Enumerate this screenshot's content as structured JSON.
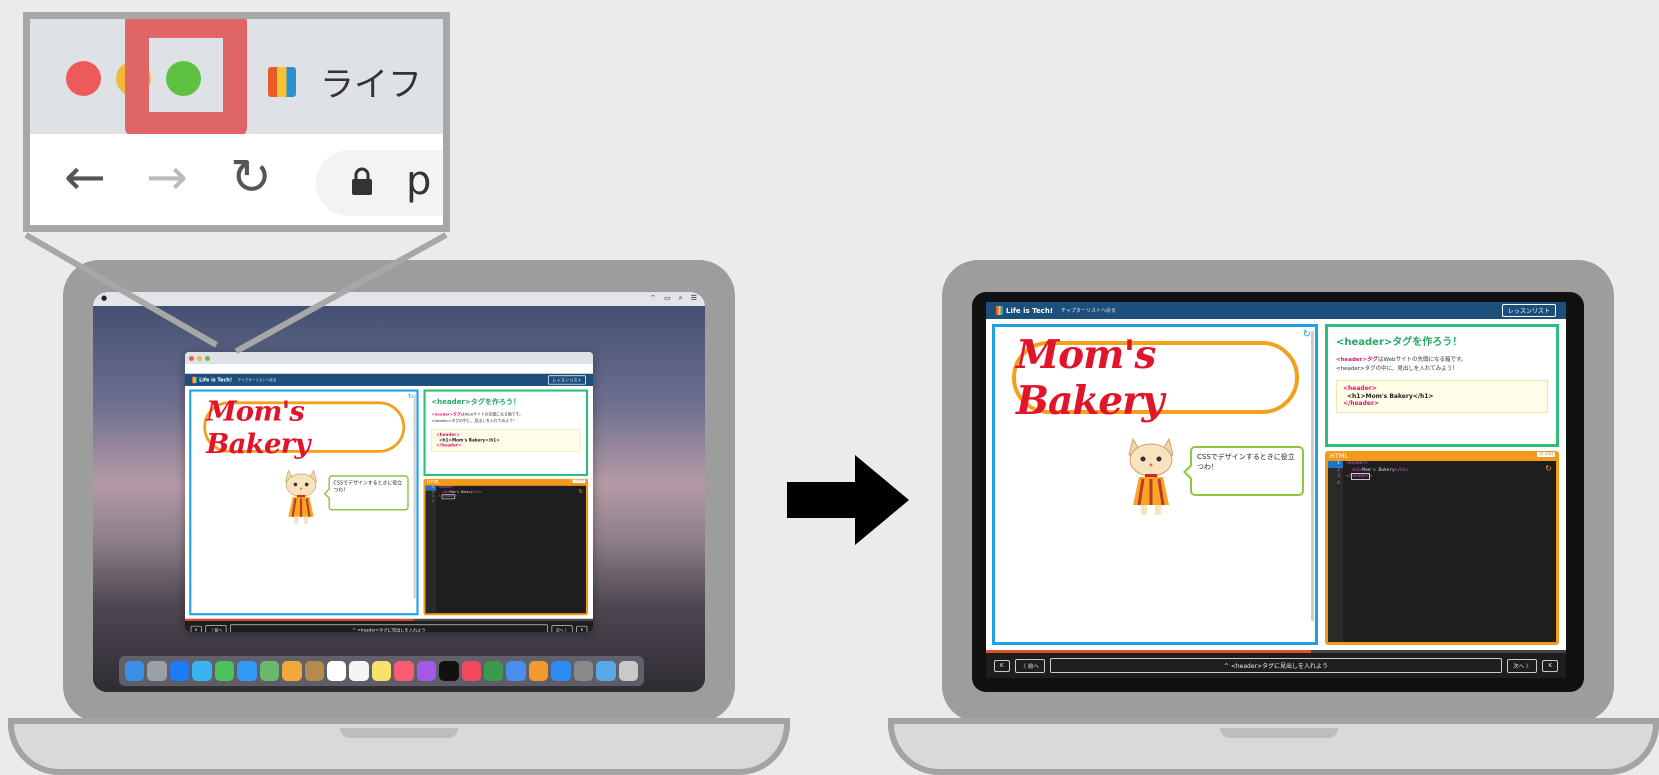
{
  "left_laptop": {
    "menubar": {
      "left_items": [
        "",
        "",
        "",
        "",
        "",
        "",
        ""
      ],
      "right_items": [
        "",
        "",
        "",
        "",
        ""
      ]
    },
    "window_url": ""
  },
  "app": {
    "logo_text": "Life is Tech!",
    "back_link": "チャプターリストへ戻る",
    "lessons_button": "レッスンリスト",
    "preview": {
      "bakery_title": "Mom's Bakery",
      "speech_bubble": "CSSでデザインするときに役立つわ！"
    },
    "instructions": {
      "title": "<header>タグを作ろう！",
      "line1_tag": "<header>タグ",
      "line1_rest": "はWebサイトの先頭になる箱です。",
      "line2": "<header>タグの中に、見出しを入れてみよう！",
      "code_open": "<header>",
      "code_inner": "<h1>Mom's Bakery</h1>",
      "code_close": "</header>"
    },
    "editor": {
      "label": "HTML",
      "zoom": "Q 100",
      "line_numbers": [
        "1",
        "2",
        "3",
        "4"
      ],
      "code_line1": "<header>",
      "code_line2_open": "<h1>",
      "code_line2_text": "Mom's Bakery",
      "code_line2_close": "</h1>",
      "code_line3_prefix": "</",
      "code_line3_tag": "header",
      "code_line3_suffix": ">"
    },
    "progress": 0.56,
    "footer": {
      "first_button": "K",
      "prev_button": "〈 前へ",
      "step_bar": "^  <header>タグに見出しを入れよう",
      "next_button": "次へ 〉",
      "last_button": "K"
    }
  },
  "magnifier": {
    "tab_title": "ライフ",
    "url_text": "p",
    "colors": {
      "close": "#ee5a5a",
      "minimize": "#f5b93a",
      "zoom": "#5ec142",
      "highlight": "#e06666"
    }
  },
  "icons": [
    "back-arrow-icon",
    "forward-arrow-icon",
    "reload-icon",
    "lock-icon",
    "right-arrow-icon",
    "cat-mascot-icon"
  ]
}
